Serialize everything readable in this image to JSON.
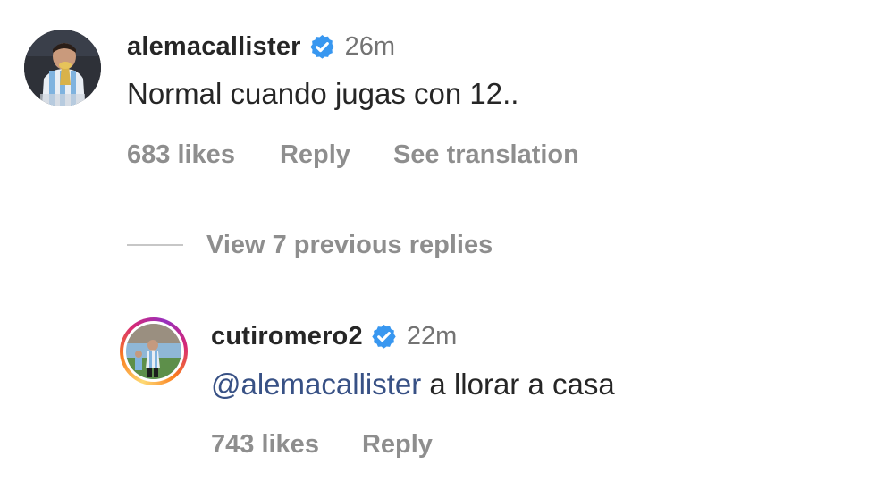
{
  "comment": {
    "username": "alemacallister",
    "verified": true,
    "timestamp": "26m",
    "text": "Normal cuando jugas con 12..",
    "likes": "683 likes",
    "reply_label": "Reply",
    "translate_label": "See translation",
    "avatar_icon": "player-kissing-trophy-avatar"
  },
  "view_replies_label": "View 7 previous replies",
  "reply": {
    "username": "cutiromero2",
    "verified": true,
    "timestamp": "22m",
    "mention": "@alemacallister",
    "text": "a llorar a casa",
    "likes": "743 likes",
    "reply_label": "Reply",
    "avatar_icon": "player-on-pitch-avatar",
    "has_story_ring": true
  },
  "colors": {
    "verified_blue": "#3897f0",
    "mention_blue": "#385185",
    "muted_text": "#8e8e8e"
  }
}
